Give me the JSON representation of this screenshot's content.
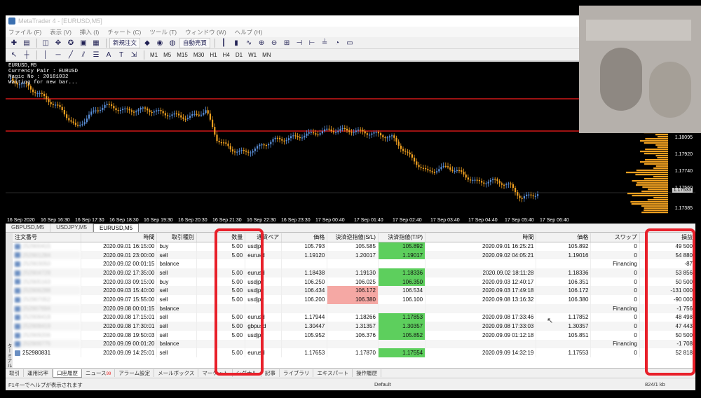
{
  "titlebar": {
    "text": "MetaTrader 4 - [EURUSD,M5]"
  },
  "menu": [
    "ファイル (F)",
    "表示 (V)",
    "挿入 (I)",
    "チャート (C)",
    "ツール (T)",
    "ウィンドウ (W)",
    "ヘルプ (H)"
  ],
  "toolbar": {
    "new_order": "新規注文",
    "auto_trade": "自動売買",
    "timeframes": [
      "M1",
      "M5",
      "M15",
      "M30",
      "H1",
      "H4",
      "D1",
      "W1",
      "MN"
    ]
  },
  "chart": {
    "info": [
      "EURUSD,M5",
      "Currency Pair : EURUSD",
      "Magic No : 20181032",
      "Waiting for new bar..."
    ],
    "x_labels": [
      "16 Sep 2020",
      "16 Sep 16:30",
      "16 Sep 17:30",
      "16 Sep 18:30",
      "16 Sep 19:30",
      "16 Sep 20:30",
      "16 Sep 21:30",
      "16 Sep 22:30",
      "16 Sep 23:30",
      "17 Sep 00:40",
      "17 Sep 01:40",
      "17 Sep 02:40",
      "17 Sep 03:40",
      "17 Sep 04:40",
      "17 Sep 05:40",
      "17 Sep 06:40"
    ],
    "y_labels": [
      "1.18095",
      "1.17920",
      "1.17740",
      "1.17560",
      "1.17385"
    ],
    "current_price": "1.17533",
    "candle_up": "#5a8fd8",
    "candle_down": "#f0a020",
    "level_line": "#d01818"
  },
  "symbol_tabs": [
    "GBPUSD,M5",
    "USDJPY,M5",
    "EURUSD,M5"
  ],
  "terminal": {
    "side_label": "ターミナル",
    "headers": [
      "注文番号",
      "時間",
      "取引種別",
      "数量",
      "通貨ペア",
      "価格",
      "決済逆指値(S/L)",
      "決済指値(T/P)",
      "時間",
      "価格",
      "スワップ",
      "損益"
    ],
    "rows": [
      {
        "ticket": "252900415",
        "time": "2020.09.01 16:15:00",
        "type": "buy",
        "qty": "5.00",
        "pair": "usdjpy",
        "price": "105.793",
        "sl": "105.585",
        "tp": "105.892",
        "ctime": "2020.09.01 16:25:21",
        "cprice": "105.892",
        "swap": "0",
        "pl": "49 500",
        "hl": "tp"
      },
      {
        "ticket": "252901284",
        "time": "2020.09.01 23:00:00",
        "type": "sell",
        "qty": "5.00",
        "pair": "eurusd",
        "price": "1.19120",
        "sl": "1.20017",
        "tp": "1.19017",
        "ctime": "2020.09.02 04:05:21",
        "cprice": "1.19016",
        "swap": "0",
        "pl": "54 880",
        "hl": "tp"
      },
      {
        "ticket": "252903050",
        "time": "2020.09.02 00:01:15",
        "type": "balance",
        "qty": "",
        "pair": "",
        "price": "",
        "sl": "",
        "tp": "",
        "ctime": "",
        "cprice": "",
        "swap": "Financing",
        "pl": "-87",
        "hl": ""
      },
      {
        "ticket": "252904729",
        "time": "2020.09.02 17:35:00",
        "type": "sell",
        "qty": "5.00",
        "pair": "eurusd",
        "price": "1.18438",
        "sl": "1.19130",
        "tp": "1.18336",
        "ctime": "2020.09.02 18:11:28",
        "cprice": "1.18336",
        "swap": "0",
        "pl": "53 856",
        "hl": "tp"
      },
      {
        "ticket": "252905163",
        "time": "2020.09.03 09:15:00",
        "type": "buy",
        "qty": "5.00",
        "pair": "usdjpy",
        "price": "106.250",
        "sl": "106.025",
        "tp": "106.350",
        "ctime": "2020.09.03 12:40:17",
        "cprice": "106.351",
        "swap": "0",
        "pl": "50 500",
        "hl": "tp"
      },
      {
        "ticket": "252906288",
        "time": "2020.09.03 15:40:00",
        "type": "sell",
        "qty": "5.00",
        "pair": "usdjpy",
        "price": "106.434",
        "sl": "106.172",
        "tp": "106.534",
        "ctime": "2020.09.03 17:49:18",
        "cprice": "106.172",
        "swap": "0",
        "pl": "-131 000",
        "hl": "sl"
      },
      {
        "ticket": "252907052",
        "time": "2020.09.07 15:55:00",
        "type": "sell",
        "qty": "5.00",
        "pair": "usdjpy",
        "price": "106.200",
        "sl": "106.380",
        "tp": "106.100",
        "ctime": "2020.09.08 13:16:32",
        "cprice": "106.380",
        "swap": "0",
        "pl": "-90 000",
        "hl": "sl"
      },
      {
        "ticket": "252907694",
        "time": "2020.09.08 00:01:15",
        "type": "balance",
        "qty": "",
        "pair": "",
        "price": "",
        "sl": "",
        "tp": "",
        "ctime": "",
        "cprice": "",
        "swap": "Financing",
        "pl": "-1 756",
        "hl": ""
      },
      {
        "ticket": "252908418",
        "time": "2020.09.08 17:15:01",
        "type": "sell",
        "qty": "5.00",
        "pair": "eurusd",
        "price": "1.17944",
        "sl": "1.18266",
        "tp": "1.17853",
        "ctime": "2020.09.08 17:33:46",
        "cprice": "1.17852",
        "swap": "0",
        "pl": "48 498",
        "hl": "tp"
      },
      {
        "ticket": "252908419",
        "time": "2020.09.08 17:30:01",
        "type": "sell",
        "qty": "5.00",
        "pair": "gbpusd",
        "price": "1.30447",
        "sl": "1.31357",
        "tp": "1.30357",
        "ctime": "2020.09.08 17:33:03",
        "cprice": "1.30357",
        "swap": "0",
        "pl": "47 443",
        "hl": "tp"
      },
      {
        "ticket": "252909206",
        "time": "2020.09.08 19:50:03",
        "type": "sell",
        "qty": "5.00",
        "pair": "usdjpy",
        "price": "105.952",
        "sl": "106.376",
        "tp": "105.852",
        "ctime": "2020.09.09 01:12:18",
        "cprice": "105.851",
        "swap": "0",
        "pl": "50 500",
        "hl": "tp"
      },
      {
        "ticket": "252909775",
        "time": "2020.09.09 00:01:20",
        "type": "balance",
        "qty": "",
        "pair": "",
        "price": "",
        "sl": "",
        "tp": "",
        "ctime": "",
        "cprice": "",
        "swap": "Financing",
        "pl": "-1 708",
        "hl": ""
      },
      {
        "ticket": "252980831",
        "time": "2020.09.09 14:25:01",
        "type": "sell",
        "qty": "5.00",
        "pair": "eurusd",
        "price": "1.17653",
        "sl": "1.17870",
        "tp": "1.17554",
        "ctime": "2020.09.09 14:32:19",
        "cprice": "1.17553",
        "swap": "0",
        "pl": "52 818",
        "hl": "tp"
      }
    ]
  },
  "bottom_tabs": [
    "取引",
    "運用比率",
    "口座履歴",
    "ニュース",
    "アラーム設定",
    "メールボックス",
    "マーケット",
    "シグナル",
    "記事",
    "ライブラリ",
    "エキスパート",
    "操作履歴"
  ],
  "news_badge": "99",
  "status": {
    "help": "F1キーでヘルプが表示されます",
    "profile": "Default",
    "traffic": "824/1 kb"
  }
}
